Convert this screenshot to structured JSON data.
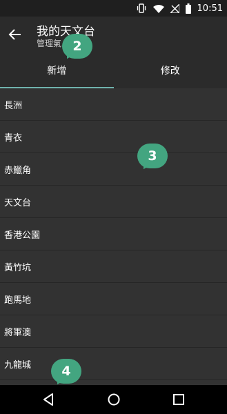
{
  "status_bar": {
    "time": "10:51",
    "icons": [
      "vibrate-icon",
      "wifi-icon",
      "no-signal-icon",
      "battery-icon"
    ]
  },
  "app_bar": {
    "title": "我的天文台",
    "subtitle": "管理氣"
  },
  "tabs": [
    {
      "label": "新增",
      "active": true
    },
    {
      "label": "修改",
      "active": false
    }
  ],
  "locations": [
    "長洲",
    "青衣",
    "赤鱲角",
    "天文台",
    "香港公園",
    "黃竹坑",
    "跑馬地",
    "將軍澳",
    "九龍城"
  ],
  "callouts": [
    "2",
    "3",
    "4"
  ],
  "colors": {
    "accent": "#6fb3ad",
    "callout": "#43a580",
    "background": "#303030"
  }
}
